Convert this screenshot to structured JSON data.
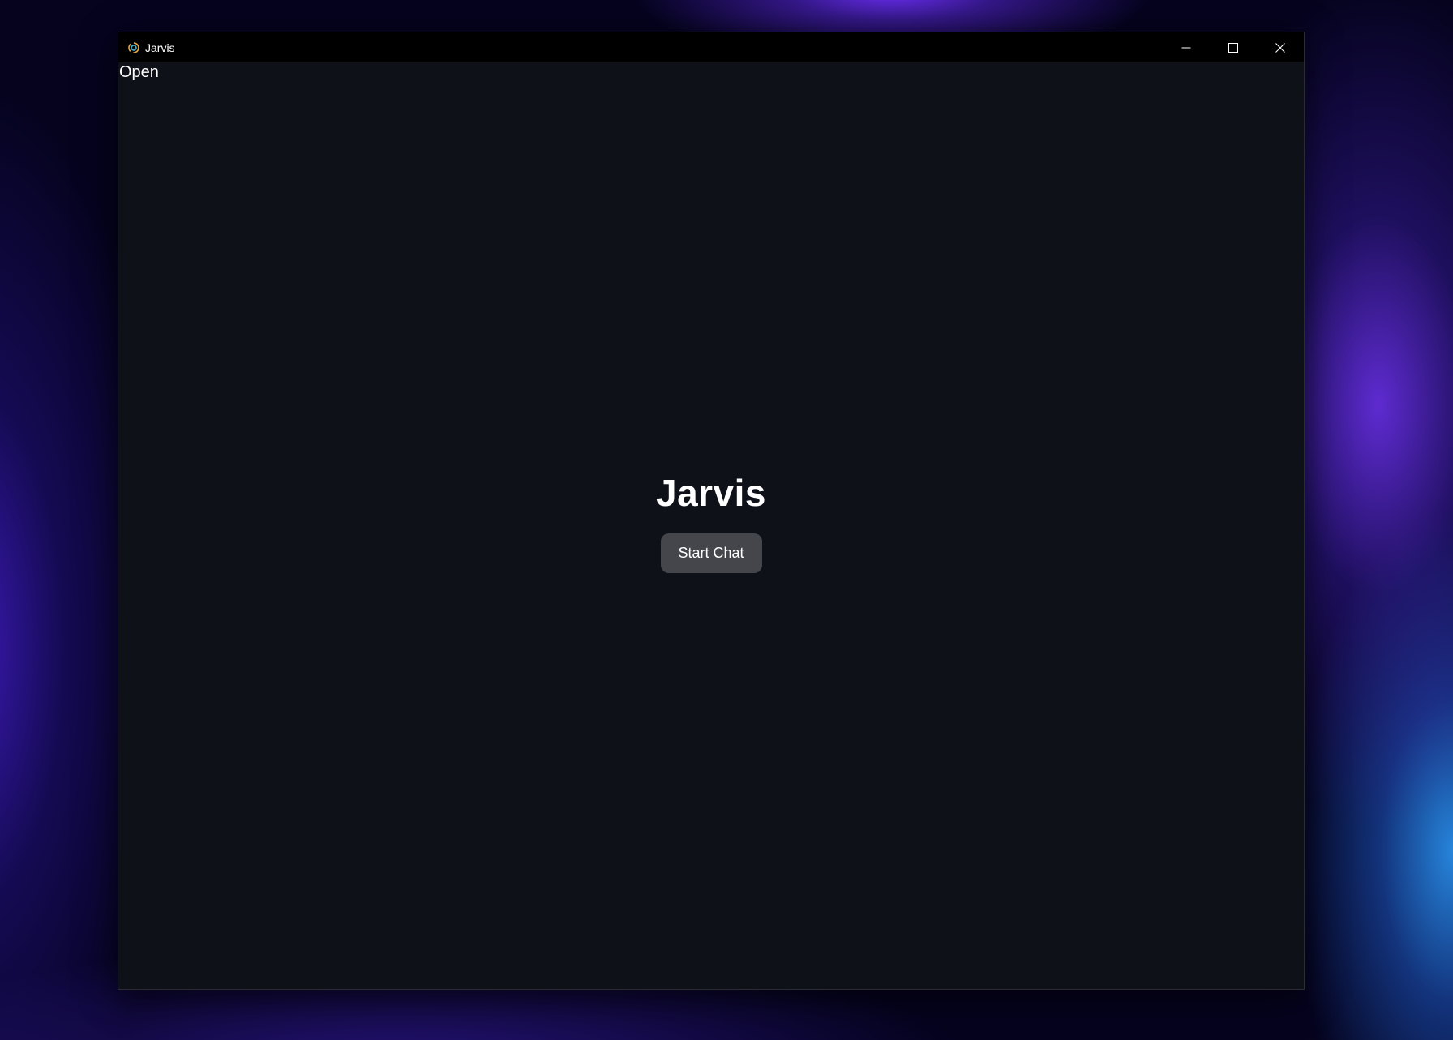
{
  "window": {
    "title": "Jarvis",
    "app_icon": "jarvis-logo-icon",
    "controls": [
      "minimize-icon",
      "maximize-icon",
      "close-icon"
    ]
  },
  "menu": {
    "open_label": "Open"
  },
  "main": {
    "heading": "Jarvis",
    "start_button_label": "Start Chat"
  },
  "colors": {
    "window_background": "#0e1118",
    "titlebar_background": "#000000",
    "button_background": "#44464c",
    "text": "#ffffff"
  }
}
